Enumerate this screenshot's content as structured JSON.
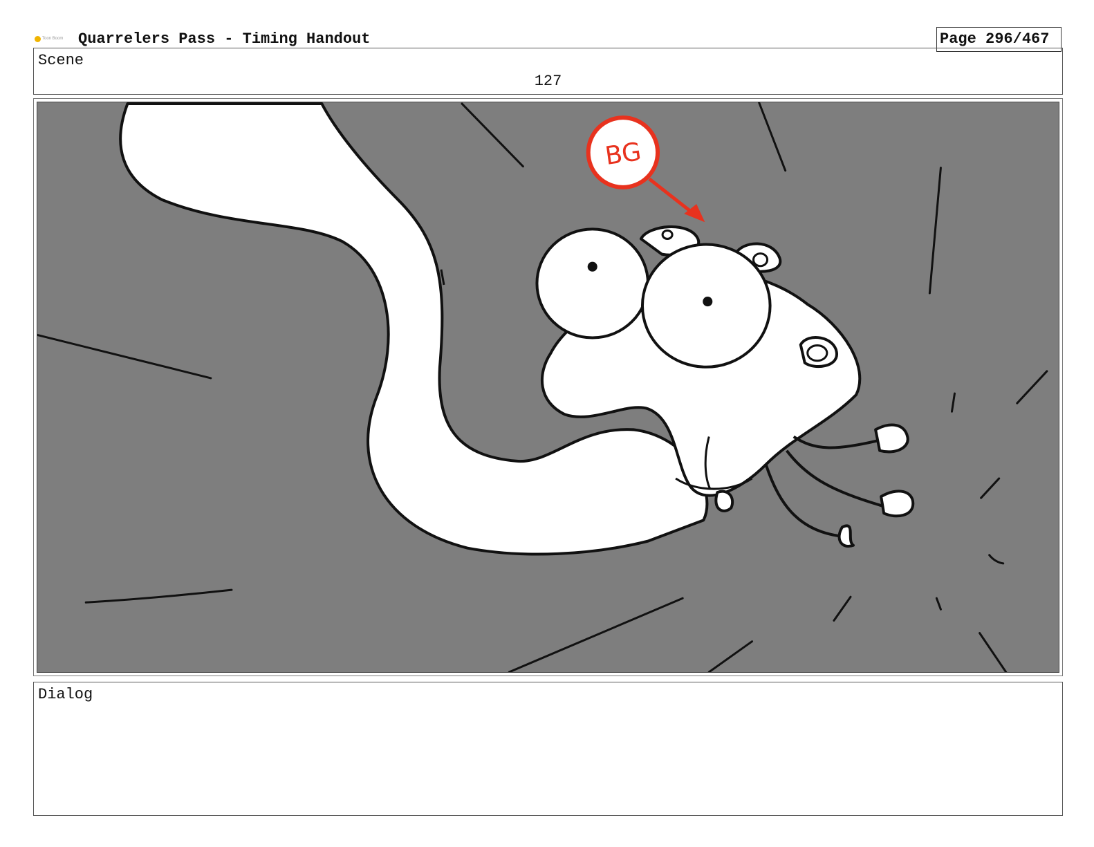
{
  "header": {
    "logo_text": "Toon Boom",
    "title": "Quarrelers Pass - Timing Handout",
    "page_label": "Page 296/467"
  },
  "scene": {
    "label": "Scene",
    "number": "127"
  },
  "panel": {
    "bg_tag": "BG",
    "bg_color": "#7e7e7e",
    "annotation_color": "#e8321e"
  },
  "dialog": {
    "label": "Dialog",
    "text": ""
  }
}
